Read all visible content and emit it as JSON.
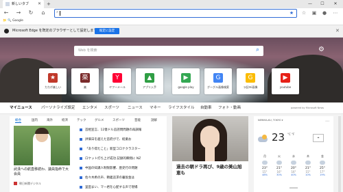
{
  "browser": {
    "tab_title": "新しいタブ",
    "tab_close": "✕",
    "new_tab": "+",
    "win_min": "—",
    "win_max": "☐",
    "win_close": "✕",
    "back": "←",
    "forward": "→",
    "refresh": "↻",
    "home": "⌂",
    "address_value": "",
    "favorites_bar": "📁  🔍 Google"
  },
  "infobar": {
    "message": "Microsoft Edge を既定のブラウザーとして設定しますか?",
    "button": "既定に設定",
    "close": "✕"
  },
  "hero": {
    "search_placeholder": "Web を検索",
    "settings": "⚙",
    "tiles": [
      {
        "label": "カカボ楽しい",
        "color": "#c0392b",
        "glyph": "★"
      },
      {
        "label": "楽",
        "color": "#7a2b2b",
        "glyph": "楽"
      },
      {
        "label": "ヤフーメール",
        "color": "#ff0033",
        "glyph": "Y"
      },
      {
        "label": "アプリ入手",
        "color": "#2f9e44",
        "glyph": "▲"
      },
      {
        "label": "google play",
        "color": "#34a853",
        "glyph": "▶"
      },
      {
        "label": "グーグル画像検索",
        "color": "#4285f4",
        "glyph": "G"
      },
      {
        "label": "ラ記mi画像",
        "color": "#fbbc05",
        "glyph": "G"
      },
      {
        "label": "youtube",
        "color": "#e62117",
        "glyph": "▶"
      }
    ]
  },
  "news_nav": {
    "items": [
      "マイニュース",
      "パーソナライズ設定",
      "エンタメ",
      "スポーツ",
      "ニュース",
      "マネー",
      "ライフスタイル",
      "自動車",
      "フォト・動画"
    ],
    "powered": "powered by Microsoft News"
  },
  "left_card": {
    "subtabs": [
      "総合",
      "国内",
      "海外",
      "経済",
      "テック",
      "グルメ",
      "スポーツ",
      "芸能",
      "謎解"
    ],
    "image_headline": "武漢への航直移続わ、議員指命で大会員",
    "source": "朝日新聞デジタル",
    "headlines": [
      "首相宣言、12億ドル追諮問問題の再調報",
      "評価日を越えた首府がで、経業お",
      "「あり得たこと」新型コロナクラスター",
      "ロケット打ち上げ成功 記録的瞬間に NZ",
      "中国の知識人制限影響、歴史行の問題",
      "佐々木希の声、頼義追求の暮仮金は",
      "里田まい、マー君を心配する声で現場"
    ]
  },
  "mid_card": {
    "headline": "過去の朝ドラ再び、9歳の美山旭恵も"
  },
  "weather": {
    "location": "NERIMA-KU, TOKYO ▾",
    "temp": "23",
    "unit": "°C °F",
    "map": "⌖",
    "more": "⋯",
    "days": [
      {
        "d": "月",
        "hi": "23°",
        "lo": "15°",
        "p": "48%"
      },
      {
        "d": "火",
        "hi": "21°",
        "lo": "16°",
        "p": "30%"
      },
      {
        "d": "水",
        "hi": "20°",
        "lo": "16°",
        "p": "40%"
      },
      {
        "d": "木",
        "hi": "21°",
        "lo": "15°",
        "p": "10%"
      },
      {
        "d": "金",
        "hi": "25°",
        "lo": "17°",
        "p": "19%"
      }
    ]
  }
}
